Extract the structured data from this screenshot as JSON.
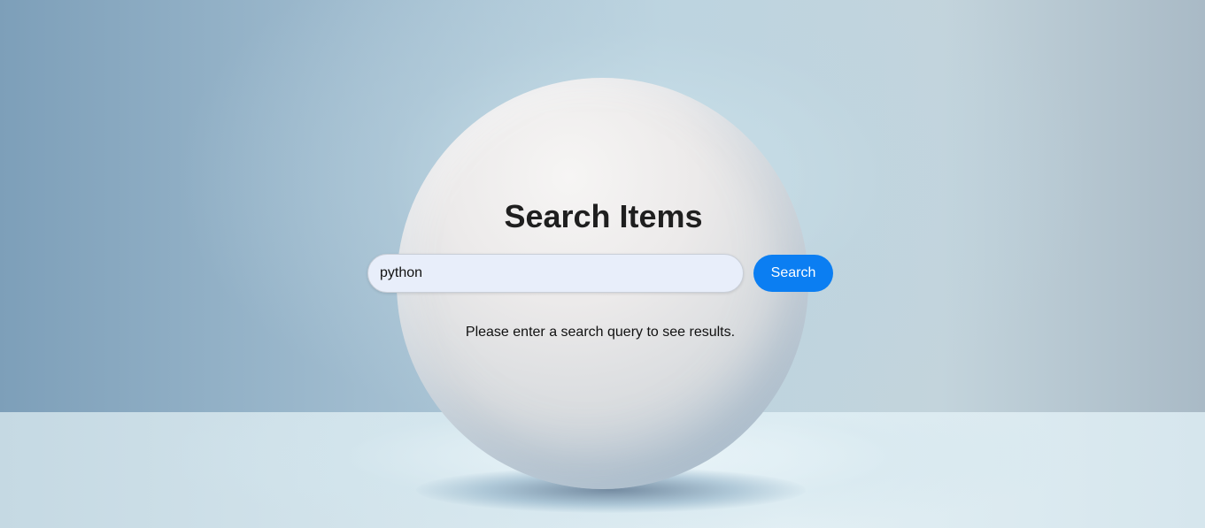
{
  "page": {
    "title": "Search Items"
  },
  "search": {
    "value": "python",
    "placeholder": "",
    "button_label": "Search"
  },
  "status": {
    "message": "Please enter a search query to see results."
  },
  "colors": {
    "accent": "#0b7ef2",
    "input_background": "#e8eefa",
    "title_text": "#1f1f1f"
  }
}
